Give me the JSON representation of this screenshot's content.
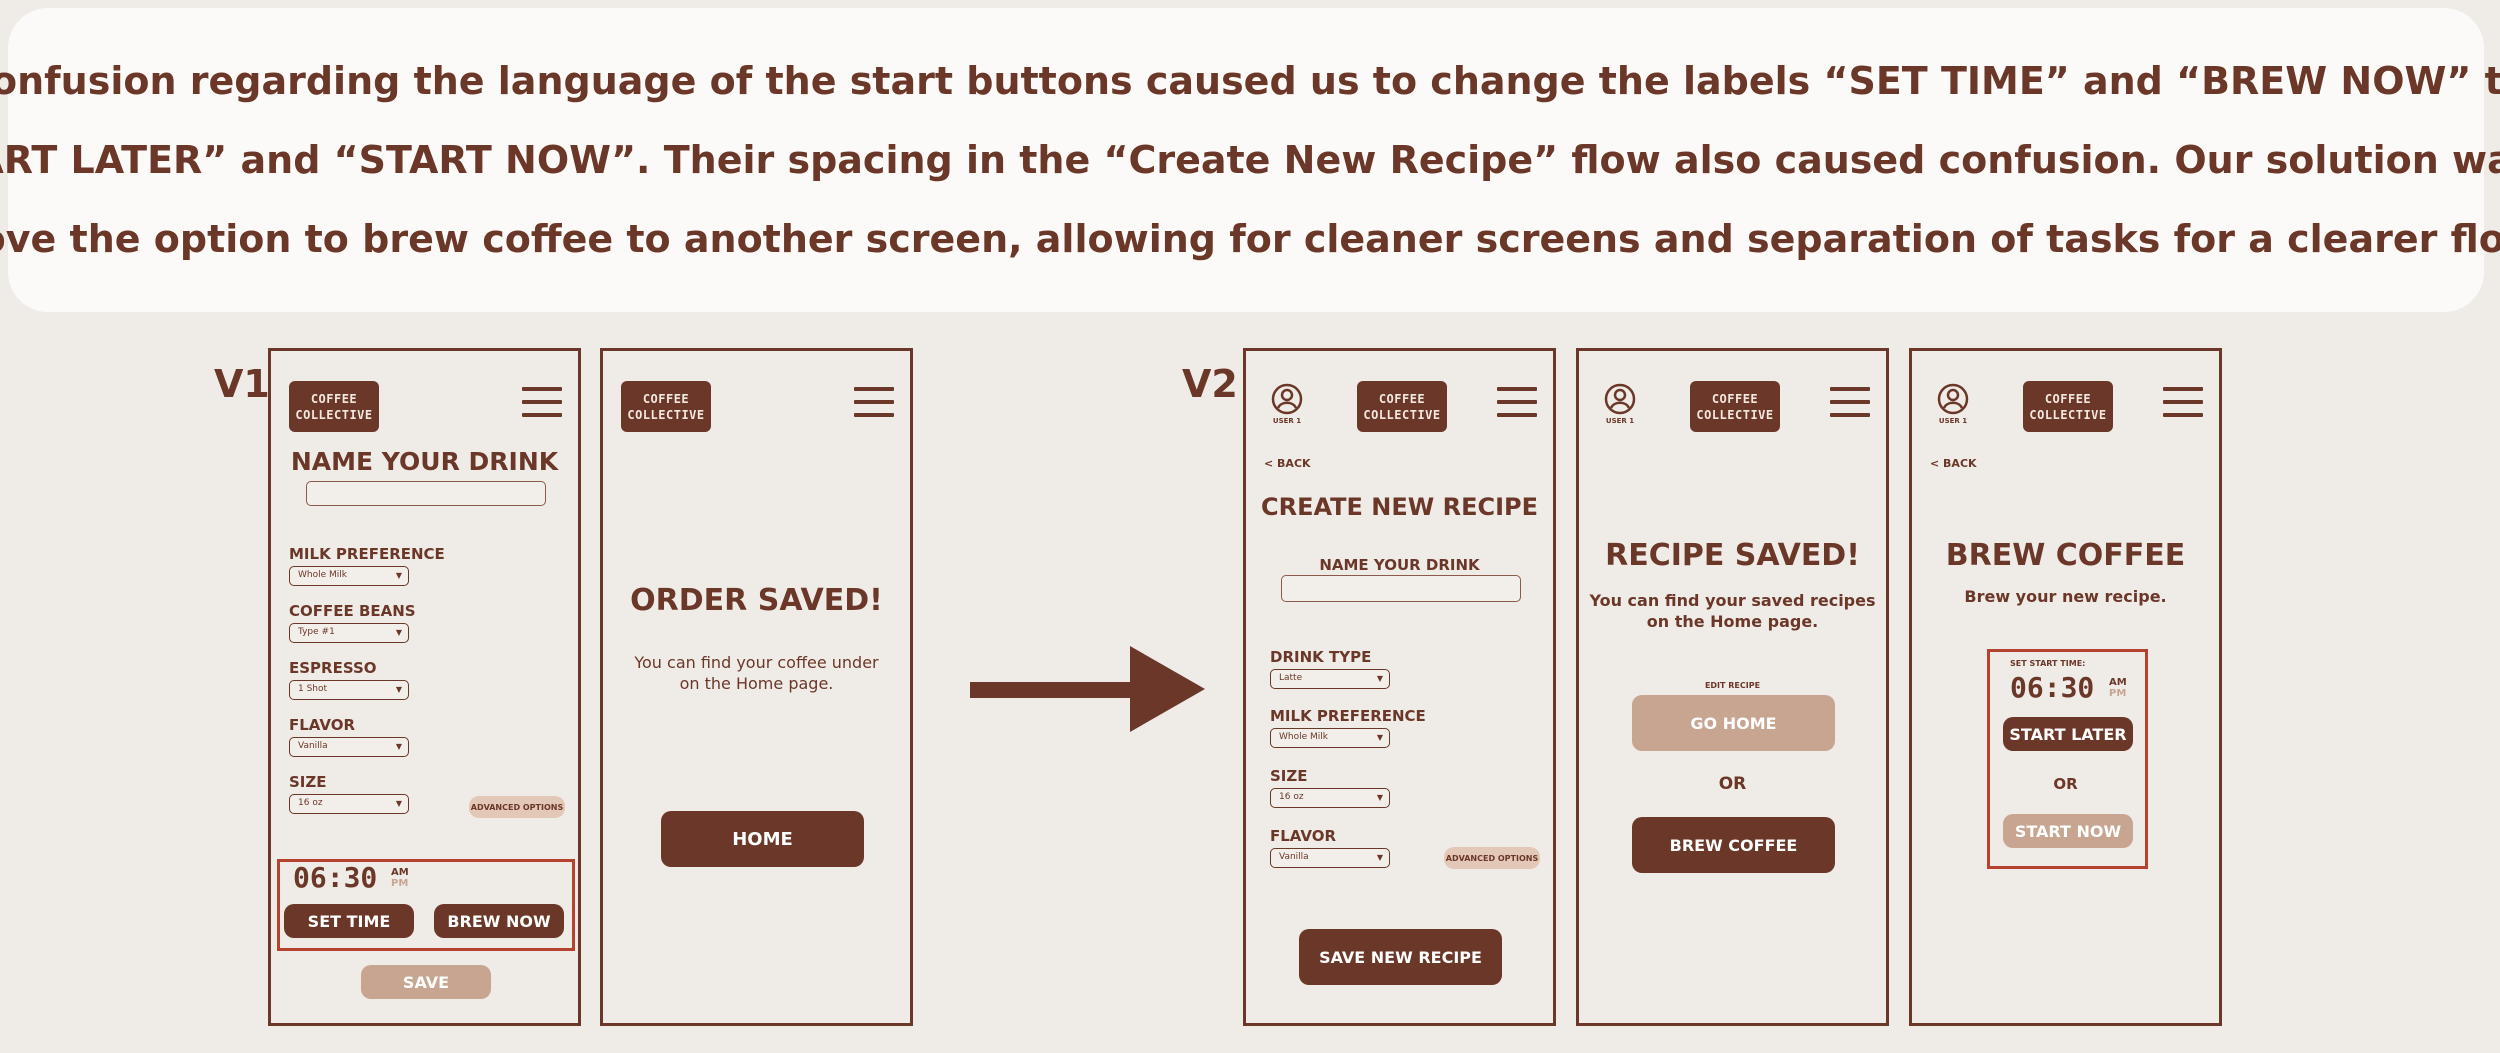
{
  "banner": {
    "line1": "Confusion regarding the language of the start buttons caused us to change the labels “SET TIME” and “BREW NOW” to",
    "line2": "“START LATER” and “START NOW”. Their spacing in the “Create New Recipe” flow also caused confusion. Our solution was to",
    "line3": "move the option to brew coffee to another screen, allowing for cleaner screens and separation of tasks for a clearer flow."
  },
  "labels": {
    "v1": "V1",
    "v2": "V2"
  },
  "logo": {
    "line1": "COFFEE",
    "line2": "COLLECTIVE"
  },
  "user_label": "USER 1",
  "back": "< BACK",
  "colors": {
    "brown": "#6b3728",
    "tan": "#c7a590",
    "background": "#efebe7",
    "highlight": "#b5422e"
  },
  "v1_screen1": {
    "title": "NAME YOUR DRINK",
    "fields": [
      {
        "label": "MILK PREFERENCE",
        "value": "Whole Milk"
      },
      {
        "label": "COFFEE BEANS",
        "value": "Type #1"
      },
      {
        "label": "ESPRESSO",
        "value": "1 Shot"
      },
      {
        "label": "FLAVOR",
        "value": "Vanilla"
      },
      {
        "label": "SIZE",
        "value": "16 oz"
      }
    ],
    "advanced": "ADVANCED OPTIONS",
    "time": "06:30",
    "am": "AM",
    "pm": "PM",
    "set_time": "SET TIME",
    "brew_now": "BREW NOW",
    "save": "SAVE"
  },
  "v1_screen2": {
    "title": "ORDER SAVED!",
    "desc1": "You can find your coffee under",
    "desc2": "on the Home page.",
    "home": "HOME"
  },
  "v2_screen1": {
    "title": "CREATE NEW RECIPE",
    "name_label": "NAME YOUR DRINK",
    "fields": [
      {
        "label": "DRINK TYPE",
        "value": "Latte"
      },
      {
        "label": "MILK PREFERENCE",
        "value": "Whole Milk"
      },
      {
        "label": "SIZE",
        "value": "16 oz"
      },
      {
        "label": "FLAVOR",
        "value": "Vanilla"
      }
    ],
    "advanced": "ADVANCED OPTIONS",
    "save": "SAVE NEW RECIPE"
  },
  "v2_screen2": {
    "title": "RECIPE SAVED!",
    "desc1": "You can find your saved recipes",
    "desc2": "on the Home page.",
    "edit": "EDIT RECIPE",
    "go_home": "GO HOME",
    "or": "OR",
    "brew": "BREW COFFEE"
  },
  "v2_screen3": {
    "title": "BREW COFFEE",
    "subtitle": "Brew your new recipe.",
    "set_start": "SET START TIME:",
    "time": "06:30",
    "am": "AM",
    "pm": "PM",
    "start_later": "START LATER",
    "or": "OR",
    "start_now": "START NOW"
  }
}
